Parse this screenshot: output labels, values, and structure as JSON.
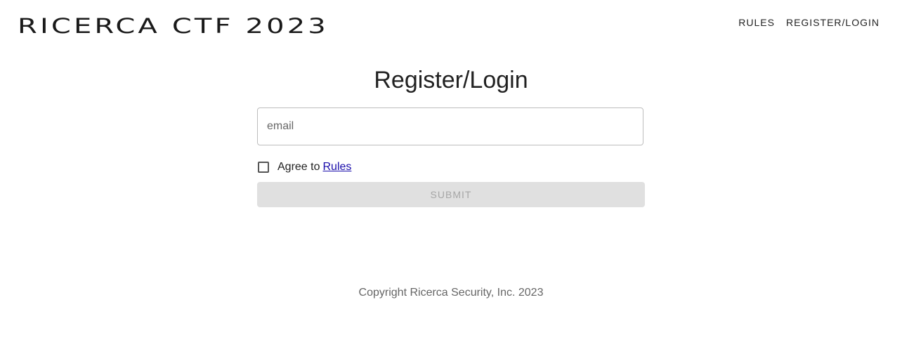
{
  "header": {
    "logo_text": "RICERCA CTF 2023",
    "nav": {
      "rules": "RULES",
      "register_login": "REGISTER/LOGIN"
    }
  },
  "main": {
    "title": "Register/Login",
    "email": {
      "placeholder": "email",
      "value": ""
    },
    "agree": {
      "checked": false,
      "text": "Agree to",
      "link_text": "Rules"
    },
    "submit_label": "SUBMIT"
  },
  "footer": {
    "copyright": "Copyright Ricerca Security, Inc. 2023"
  },
  "colors": {
    "link": "#1a0dab",
    "button_disabled_bg": "#e0e0e0",
    "button_disabled_text": "#a6a6a6"
  }
}
